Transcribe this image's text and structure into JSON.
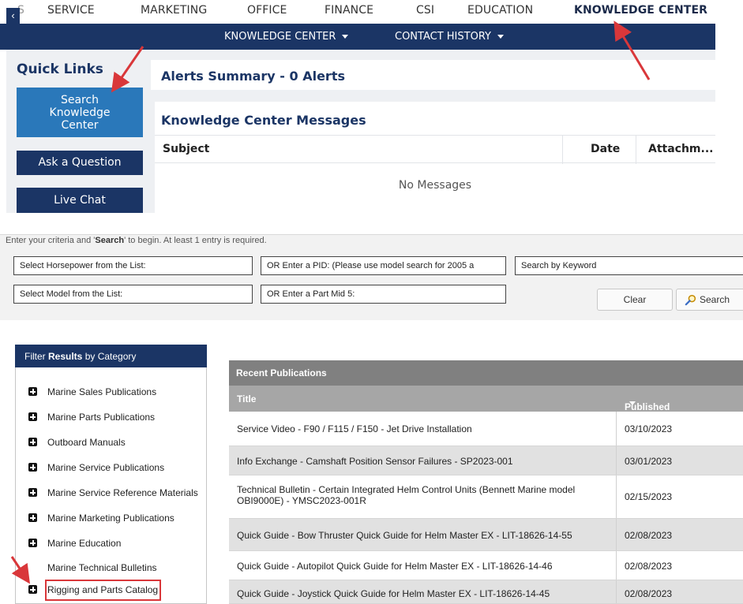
{
  "top_nav": {
    "items": [
      "S",
      "SERVICE",
      "MARKETING",
      "OFFICE",
      "FINANCE",
      "CSI",
      "EDUCATION",
      "KNOWLEDGE CENTER"
    ],
    "collapse_icon": "chevron-left-icon"
  },
  "sub_nav": {
    "items": [
      "KNOWLEDGE CENTER",
      "CONTACT HISTORY"
    ]
  },
  "quick_links": {
    "title": "Quick Links",
    "search_line1": "Search",
    "search_line2": "Knowledge",
    "search_line3": "Center",
    "ask": "Ask a Question",
    "chat": "Live Chat"
  },
  "alerts": {
    "title": "Alerts Summary - 0 Alerts"
  },
  "messages": {
    "title": "Knowledge Center Messages",
    "columns": [
      "Subject",
      "Date",
      "Attachm..."
    ],
    "empty": "No Messages"
  },
  "search": {
    "hint_pre": "Enter your criteria and '",
    "hint_bold": "Search",
    "hint_post": "' to begin. At least 1 entry is required.",
    "horsepower": "Select Horsepower from the List:",
    "pid": "OR Enter a PID: (Please use model search for 2005 a",
    "keyword": "Search by Keyword",
    "model": "Select Model from the List:",
    "mid5": "OR Enter a Part Mid 5:",
    "clear": "Clear",
    "search": "Search"
  },
  "filter": {
    "title_pre": "Filter ",
    "title_bold": "Results",
    "title_post": " by Category",
    "categories": [
      "Marine Sales Publications",
      "Marine Parts Publications",
      "Outboard Manuals",
      "Marine Service Publications",
      "Marine Service Reference Materials",
      "Marine Marketing Publications",
      "Marine Education",
      "Marine Technical Bulletins",
      "Rigging and Parts Catalog"
    ]
  },
  "publications": {
    "title": "Recent Publications",
    "col_title": "Title",
    "col_date": "Published Date",
    "rows": [
      {
        "title": "Service Video - F90 / F115 / F150 - Jet Drive Installation",
        "date": "03/10/2023"
      },
      {
        "title": "Info Exchange - Camshaft Position Sensor Failures - SP2023-001",
        "date": "03/01/2023"
      },
      {
        "title_line1": "Technical Bulletin - Certain Integrated Helm Control Units (Bennett Marine model",
        "title_line2": "OBI9000E) - YMSC2023-001R",
        "date": "02/15/2023"
      },
      {
        "title": "Quick Guide - Bow Thruster Quick Guide for Helm Master EX - LIT-18626-14-55",
        "date": "02/08/2023"
      },
      {
        "title": "Quick Guide - Autopilot Quick Guide for Helm Master EX - LIT-18626-14-46",
        "date": "02/08/2023"
      },
      {
        "title": "Quick Guide - Joystick Quick Guide for Helm Master EX - LIT-18626-14-45",
        "date": "02/08/2023"
      }
    ]
  },
  "colors": {
    "navy": "#1b3565",
    "blue_button": "#2a78ba",
    "annotation_red": "#d9373a"
  }
}
